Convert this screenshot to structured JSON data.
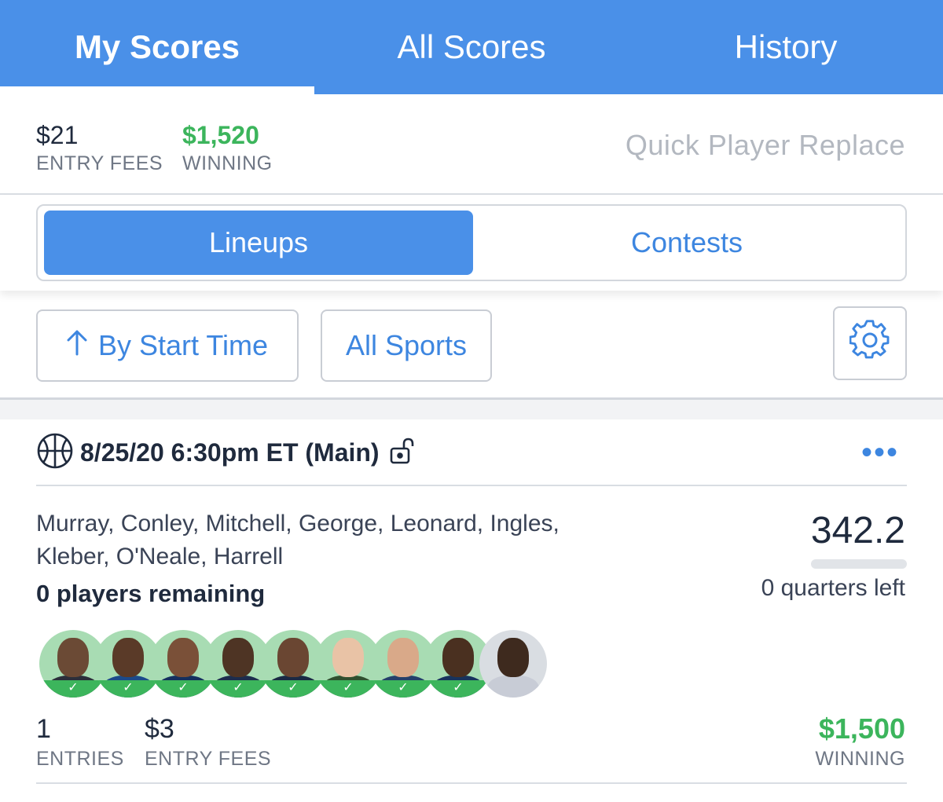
{
  "nav": {
    "tabs": [
      {
        "label": "My Scores",
        "active": true
      },
      {
        "label": "All Scores",
        "active": false
      },
      {
        "label": "History",
        "active": false
      }
    ]
  },
  "summary": {
    "entry_fees_value": "$21",
    "entry_fees_label": "ENTRY FEES",
    "winning_value": "$1,520",
    "winning_label": "WINNING",
    "quick_replace": "Quick Player Replace"
  },
  "segment": {
    "lineups": "Lineups",
    "contests": "Contests",
    "selected": "Lineups"
  },
  "filters": {
    "sort_label": "By Start Time",
    "sort_icon": "arrow-up-icon",
    "sports_label": "All Sports",
    "settings_icon": "gear-icon"
  },
  "card": {
    "sport_icon": "basketball-icon",
    "title": "8/25/20 6:30pm ET (Main)",
    "lock_icon": "unlocked-lock-icon",
    "more_icon": "more-dots-icon",
    "players_line1": "Murray, Conley, Mitchell, George, Leonard, Ingles,",
    "players_line2": "Kleber, O'Neale, Harrell",
    "remaining": "0 players remaining",
    "score": "342.2",
    "quarters_left": "0 quarters left",
    "entries_value": "1",
    "entries_label": "ENTRIES",
    "entry_fees_value": "$3",
    "entry_fees_label": "ENTRY FEES",
    "winning_value": "$1,500",
    "winning_label": "WINNING"
  },
  "avatars": [
    {
      "status": "done",
      "check": "✓"
    },
    {
      "status": "done",
      "check": "✓"
    },
    {
      "status": "done",
      "check": "✓"
    },
    {
      "status": "done",
      "check": "✓"
    },
    {
      "status": "done",
      "check": "✓"
    },
    {
      "status": "done",
      "check": "✓"
    },
    {
      "status": "done",
      "check": "✓"
    },
    {
      "status": "done",
      "check": "✓"
    },
    {
      "status": "pending",
      "check": ""
    }
  ],
  "colors": {
    "brand_blue": "#4a90e8",
    "link_blue": "#3d86e0",
    "win_green": "#3cb55c"
  }
}
